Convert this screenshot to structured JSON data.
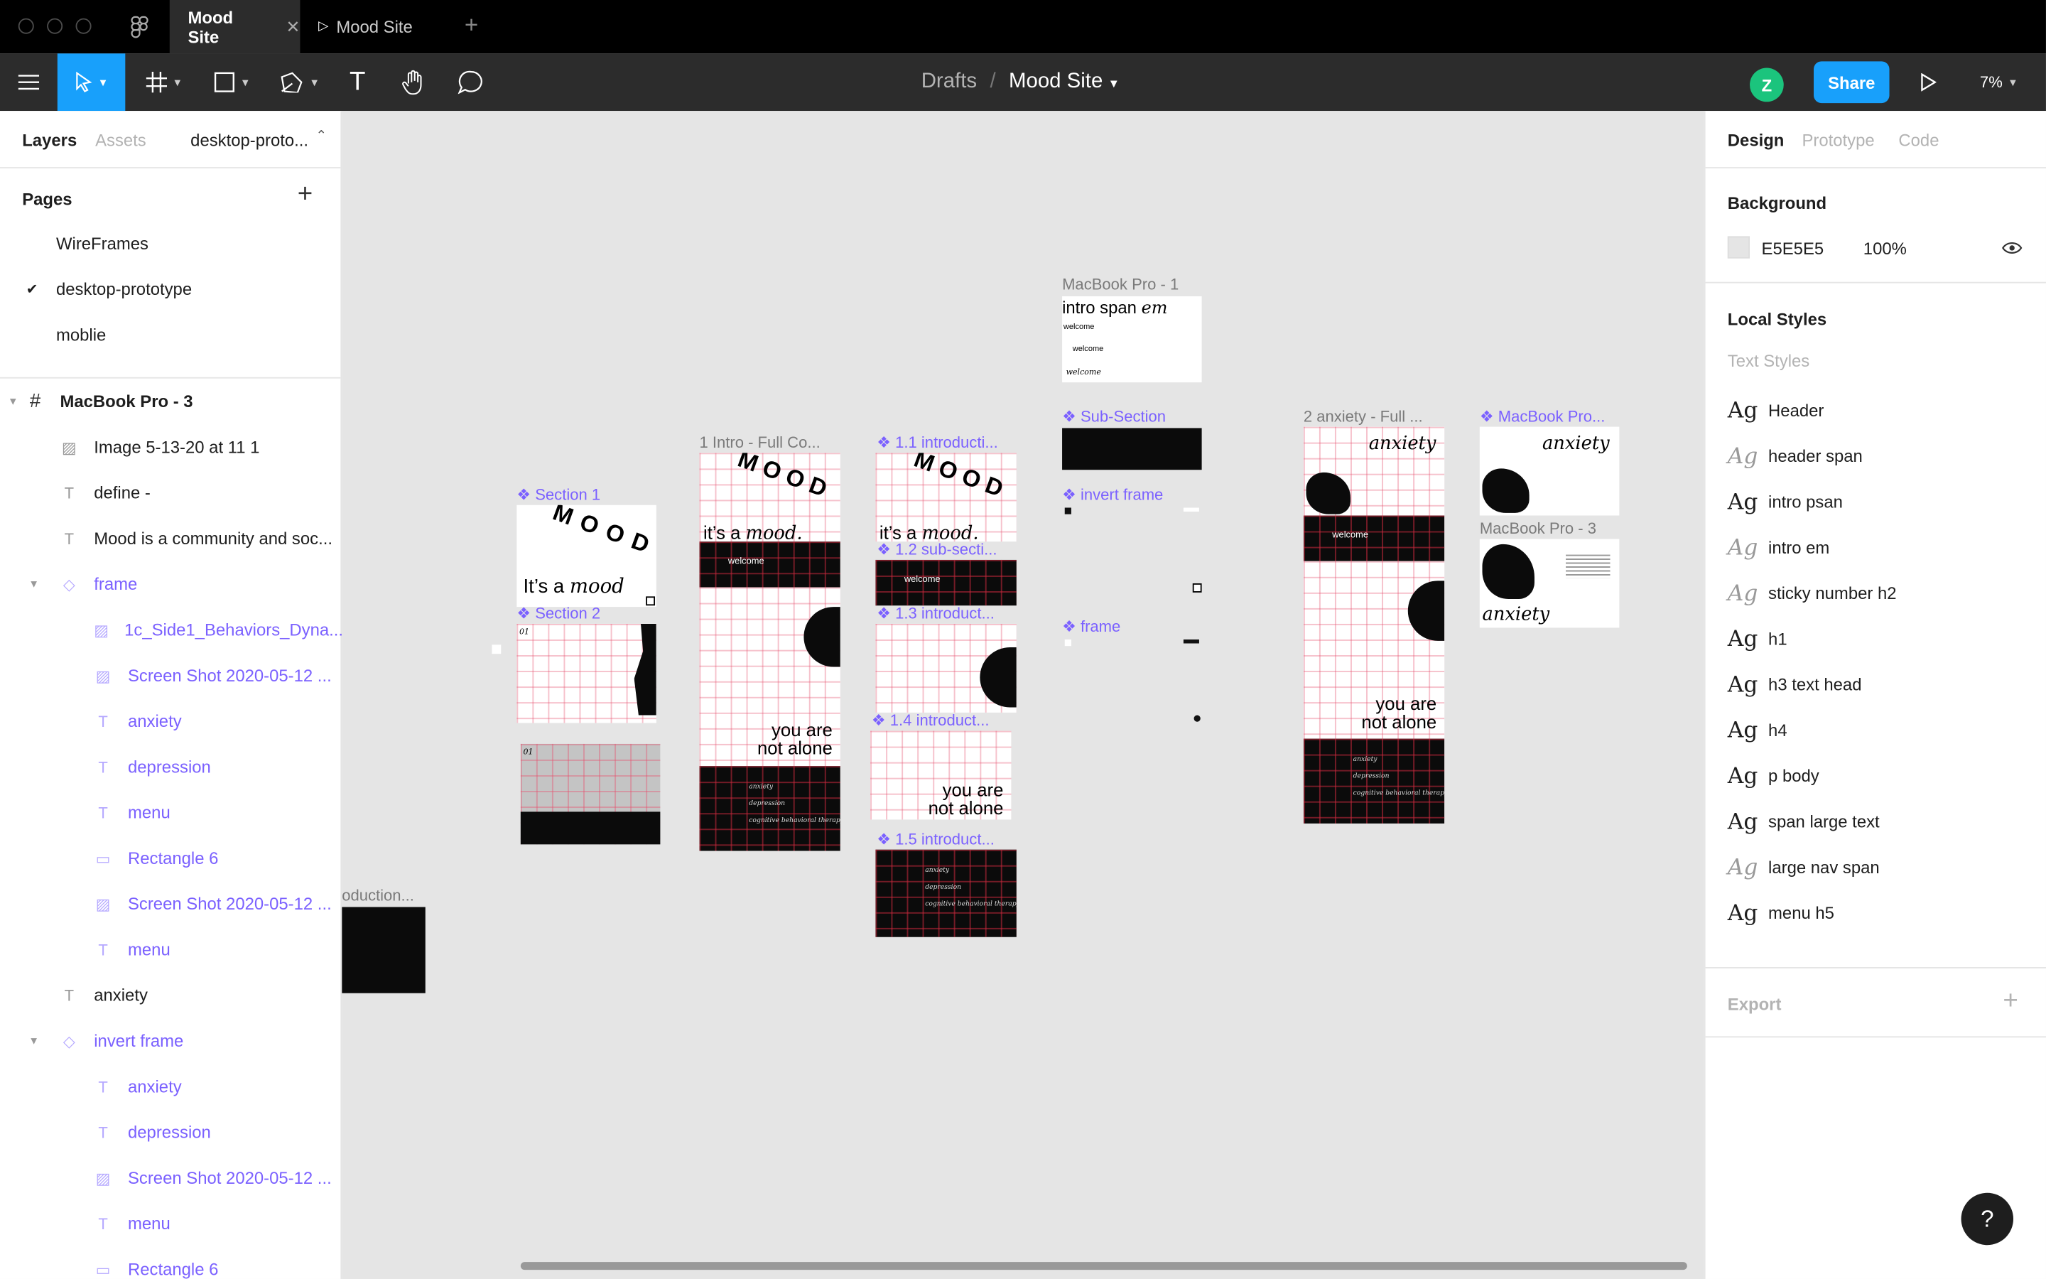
{
  "tabs": [
    {
      "label": "Mood Site"
    },
    {
      "label": "Mood Site"
    }
  ],
  "toolbar": {
    "breadcrumb_parent": "Drafts",
    "breadcrumb_sep": "/",
    "file_name": "Mood Site",
    "user_initial": "Z",
    "share": "Share",
    "zoom": "7%"
  },
  "left_panel": {
    "tabs": [
      "Layers",
      "Assets"
    ],
    "page_dropdown": "desktop-proto...",
    "pages_title": "Pages",
    "pages": [
      {
        "label": "WireFrames",
        "selected": false
      },
      {
        "label": "desktop-prototype",
        "selected": true
      },
      {
        "label": "moblie",
        "selected": false
      }
    ],
    "layers": [
      {
        "label": "MacBook Pro - 3",
        "icon": "frame-icon"
      },
      {
        "label": "Image 5-13-20 at 11 1",
        "icon": "image-icon"
      },
      {
        "label": "define -",
        "icon": "text-icon"
      },
      {
        "label": "Mood is a community and soc...",
        "icon": "text-icon"
      },
      {
        "label": "frame",
        "icon": "component-icon"
      },
      {
        "label": "1c_Side1_Behaviors_Dyna...",
        "icon": "image-icon"
      },
      {
        "label": "Screen Shot 2020-05-12 ...",
        "icon": "image-icon"
      },
      {
        "label": "anxiety",
        "icon": "text-icon"
      },
      {
        "label": "depression",
        "icon": "text-icon"
      },
      {
        "label": "menu",
        "icon": "text-icon"
      },
      {
        "label": "Rectangle 6",
        "icon": "rectangle-icon"
      },
      {
        "label": "Screen Shot 2020-05-12 ...",
        "icon": "image-icon"
      },
      {
        "label": "menu",
        "icon": "text-icon"
      },
      {
        "label": "anxiety",
        "icon": "text-icon"
      },
      {
        "label": "invert frame",
        "icon": "component-icon"
      },
      {
        "label": "anxiety",
        "icon": "text-icon"
      },
      {
        "label": "depression",
        "icon": "text-icon"
      },
      {
        "label": "Screen Shot 2020-05-12 ...",
        "icon": "image-icon"
      },
      {
        "label": "menu",
        "icon": "text-icon"
      },
      {
        "label": "Rectangle 6",
        "icon": "rectangle-icon"
      }
    ]
  },
  "right_panel": {
    "tabs": [
      "Design",
      "Prototype",
      "Code"
    ],
    "background_title": "Background",
    "bg_hex": "E5E5E5",
    "bg_opacity": "100%",
    "bg_color": "#e5e5e5",
    "local_styles_title": "Local Styles",
    "text_styles_title": "Text Styles",
    "ag": "Ag",
    "text_styles": [
      {
        "label": "Header",
        "italic": false
      },
      {
        "label": "header span",
        "italic": true
      },
      {
        "label": "intro psan",
        "italic": false
      },
      {
        "label": "intro em",
        "italic": true
      },
      {
        "label": "sticky number h2",
        "italic": true
      },
      {
        "label": "h1",
        "italic": false
      },
      {
        "label": "h3 text head",
        "italic": false
      },
      {
        "label": "h4",
        "italic": false
      },
      {
        "label": "p body",
        "italic": false
      },
      {
        "label": "span large text",
        "italic": false
      },
      {
        "label": "large nav span",
        "italic": true
      },
      {
        "label": "menu h5",
        "italic": false
      }
    ],
    "export_title": "Export"
  },
  "canvas": {
    "labels": {
      "section1": "Section 1",
      "section2": "Section 2",
      "intro_full": "1 Intro - Full Co...",
      "s11": "1.1 introducti...",
      "s12": "1.2 sub-secti...",
      "s13": "1.3  introduct...",
      "s14": "1.4  introduct...",
      "s15": "1.5  introduct...",
      "mbp1": "MacBook Pro - 1",
      "subsection": "Sub-Section",
      "invert": "invert frame",
      "frame": "frame",
      "anxiety_full": "2 anxiety - Full ...",
      "mbp_comp": "MacBook Pro...",
      "mbp3": "MacBook Pro - 3",
      "oduction": "oduction..."
    },
    "art": {
      "mood": "M O O D",
      "its_a": "It’s a",
      "mood_word": "mood",
      "its_a_lower": "it’s a",
      "mood_period": "mood.",
      "welcome": "welcome",
      "you_are": "you are",
      "not_alone": "not alone",
      "anxiety": "anxiety",
      "depression": "depression",
      "cbt": "cognitive behavioral therapy",
      "intro_span": "intro span",
      "em": "em",
      "num01": "01"
    }
  }
}
